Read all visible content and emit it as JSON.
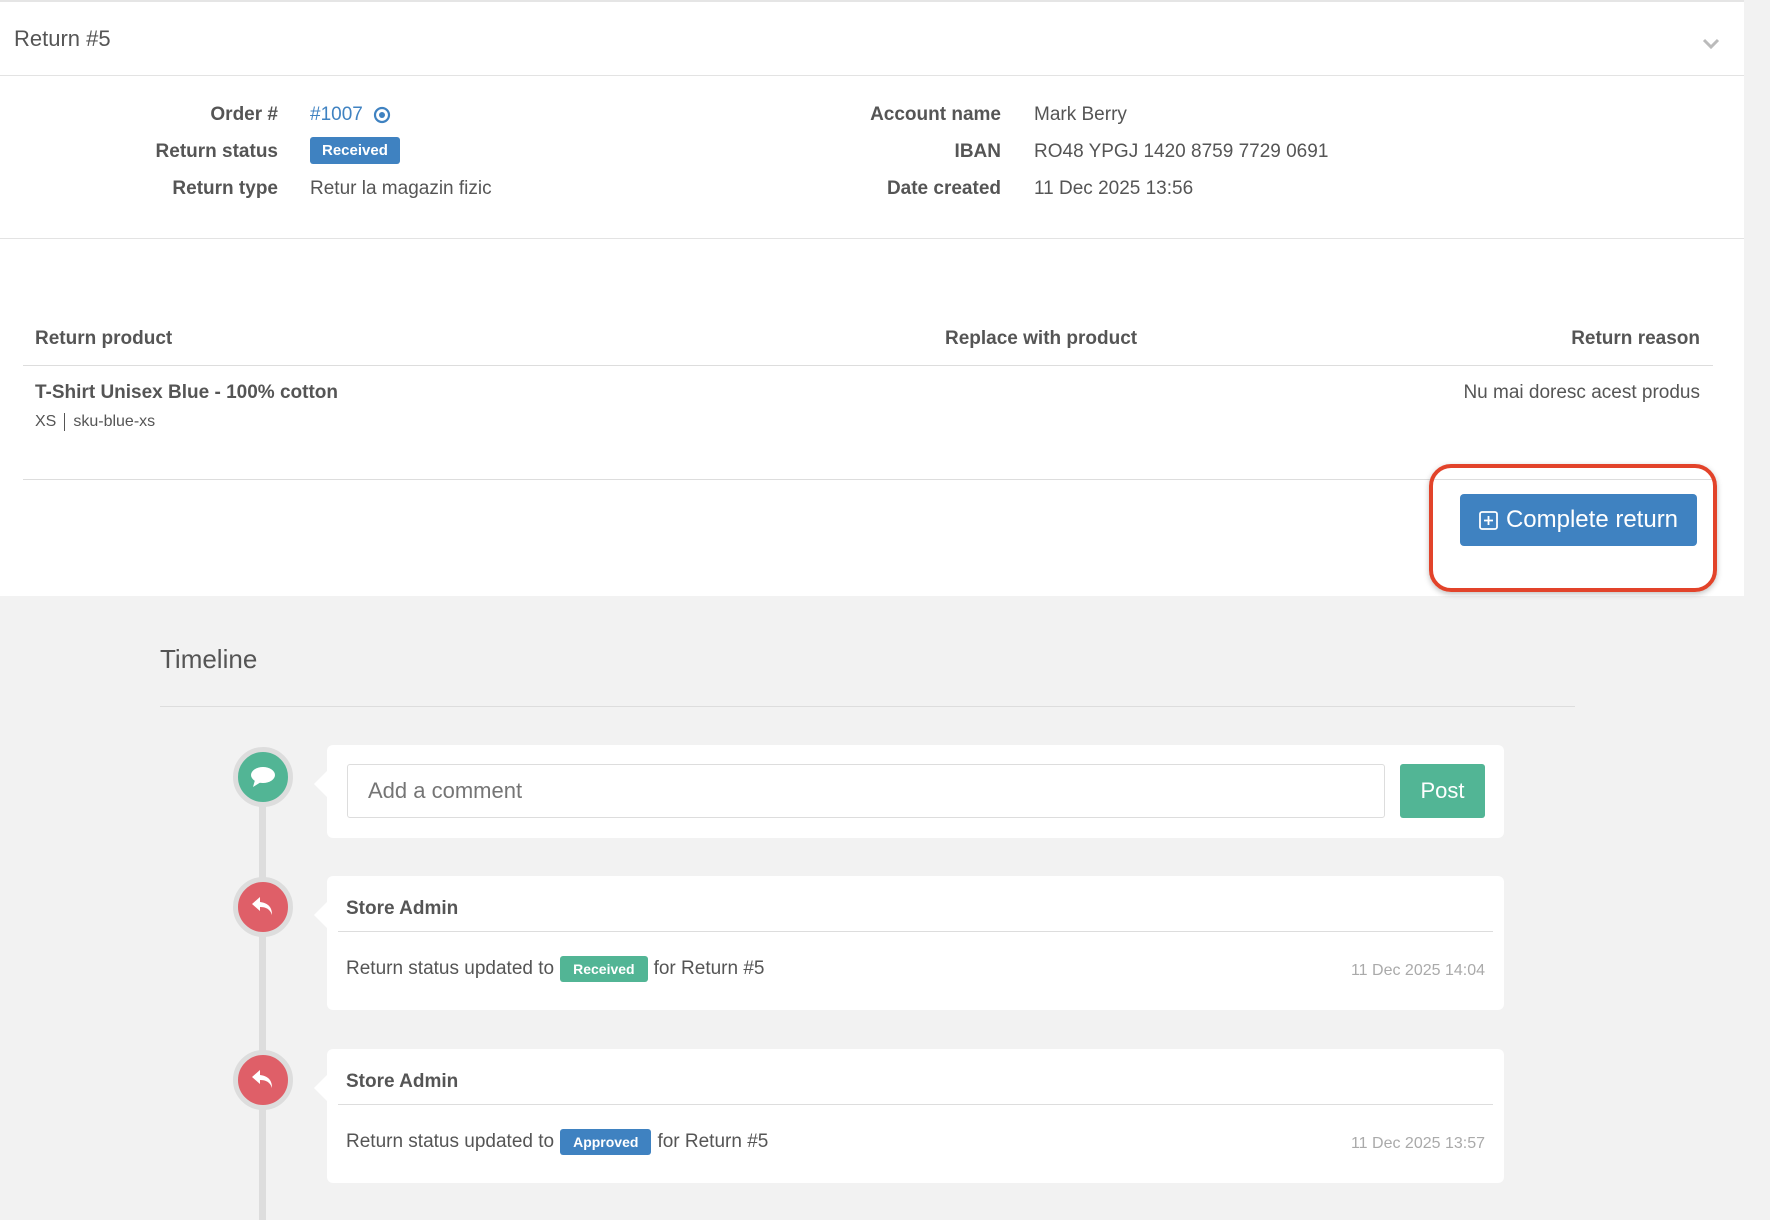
{
  "header": {
    "title": "Return #5"
  },
  "info": {
    "order_label": "Order #",
    "order_value": "#1007",
    "status_label": "Return status",
    "status_value": "Received",
    "type_label": "Return type",
    "type_value": "Retur la magazin fizic",
    "account_label": "Account name",
    "account_value": "Mark Berry",
    "iban_label": "IBAN",
    "iban_value": "RO48 YPGJ 1420 8759 7729 0691",
    "date_label": "Date created",
    "date_value": "11 Dec 2025 13:56"
  },
  "table": {
    "headers": [
      "Return product",
      "Replace with product",
      "Return reason"
    ],
    "rows": [
      {
        "product": "T-Shirt Unisex Blue - 100% cotton",
        "size": "XS",
        "sku": "sku-blue-xs",
        "replace": "",
        "reason": "Nu mai doresc acest produs"
      }
    ]
  },
  "actions": {
    "complete_label": "Complete return"
  },
  "timeline": {
    "title": "Timeline",
    "comment_placeholder": "Add a comment",
    "post_label": "Post",
    "events": [
      {
        "author": "Store Admin",
        "prefix": "Return status updated to",
        "status": "Received",
        "suffix": "for Return #5",
        "time": "11 Dec 2025 14:04",
        "status_color": "#52b595"
      },
      {
        "author": "Store Admin",
        "prefix": "Return status updated to",
        "status": "Approved",
        "suffix": "for Return #5",
        "time": "11 Dec 2025 13:57",
        "status_color": "#3f82c1"
      }
    ]
  },
  "colors": {
    "primary": "#3f82c1",
    "success": "#52b595",
    "danger": "#df5f68",
    "highlight": "#e2432a"
  }
}
